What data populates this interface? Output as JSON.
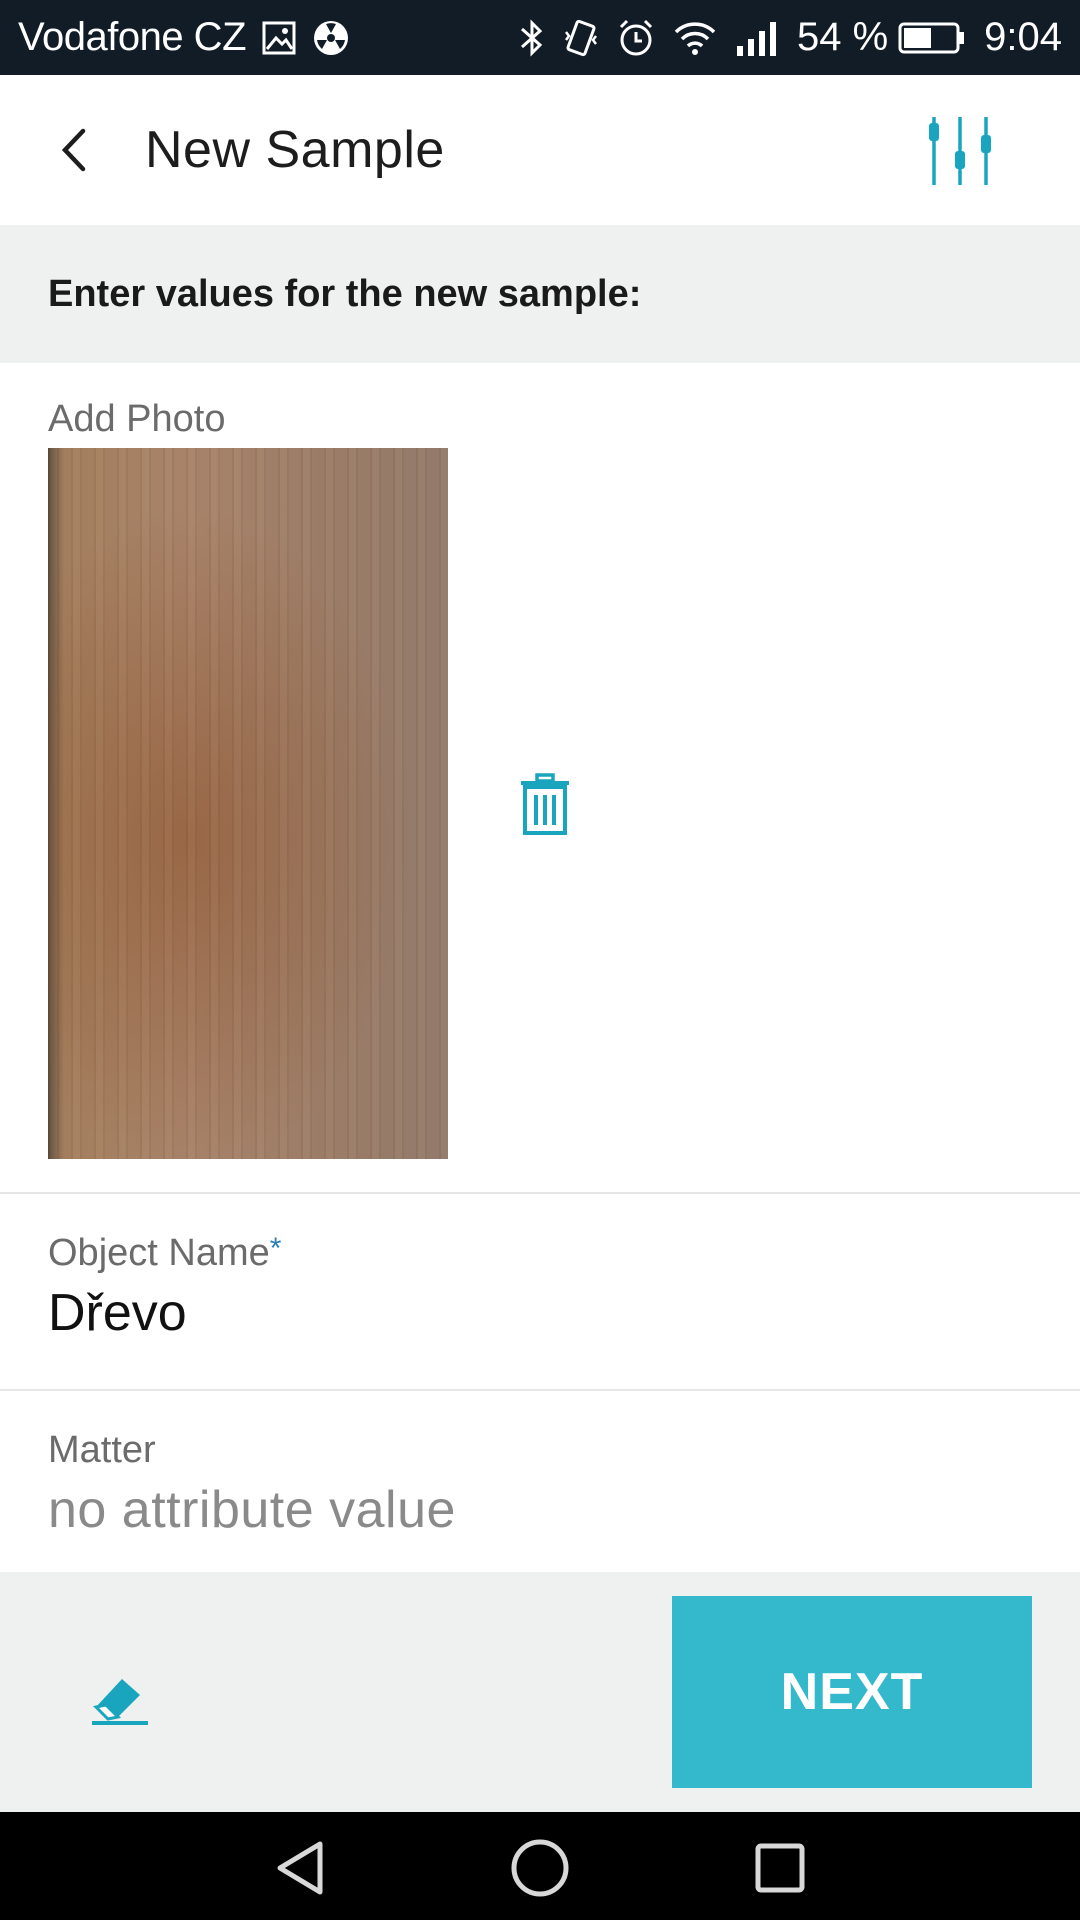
{
  "status_bar": {
    "carrier": "Vodafone CZ",
    "battery_text": "54 %",
    "battery_level": 0.54,
    "time": "9:04",
    "icons": [
      "image-icon",
      "radiation-icon",
      "bluetooth-icon",
      "vibrate-icon",
      "alarm-icon",
      "wifi-icon",
      "signal-icon",
      "battery-icon"
    ]
  },
  "app_bar": {
    "title": "New Sample",
    "back_icon": "chevron-left-icon",
    "filter_icon": "sliders-icon"
  },
  "instruction": "Enter values for the new sample:",
  "photo_section": {
    "label": "Add Photo",
    "delete_icon": "trash-icon"
  },
  "fields": {
    "object_name": {
      "label": "Object Name",
      "required_mark": "*",
      "value": "Dřevo"
    },
    "matter": {
      "label": "Matter",
      "placeholder": "no attribute value"
    }
  },
  "bottom_bar": {
    "clear_icon": "eraser-icon",
    "next_label": "NEXT"
  },
  "nav_bar": {
    "icons": [
      "back-triangle-icon",
      "home-circle-icon",
      "recents-square-icon"
    ]
  },
  "colors": {
    "accent": "#33b8cc",
    "icon_accent": "#1aa5be",
    "status_bar_bg": "#121c26",
    "banner_bg": "#eff1f1",
    "required_star": "#2a7fb4"
  }
}
